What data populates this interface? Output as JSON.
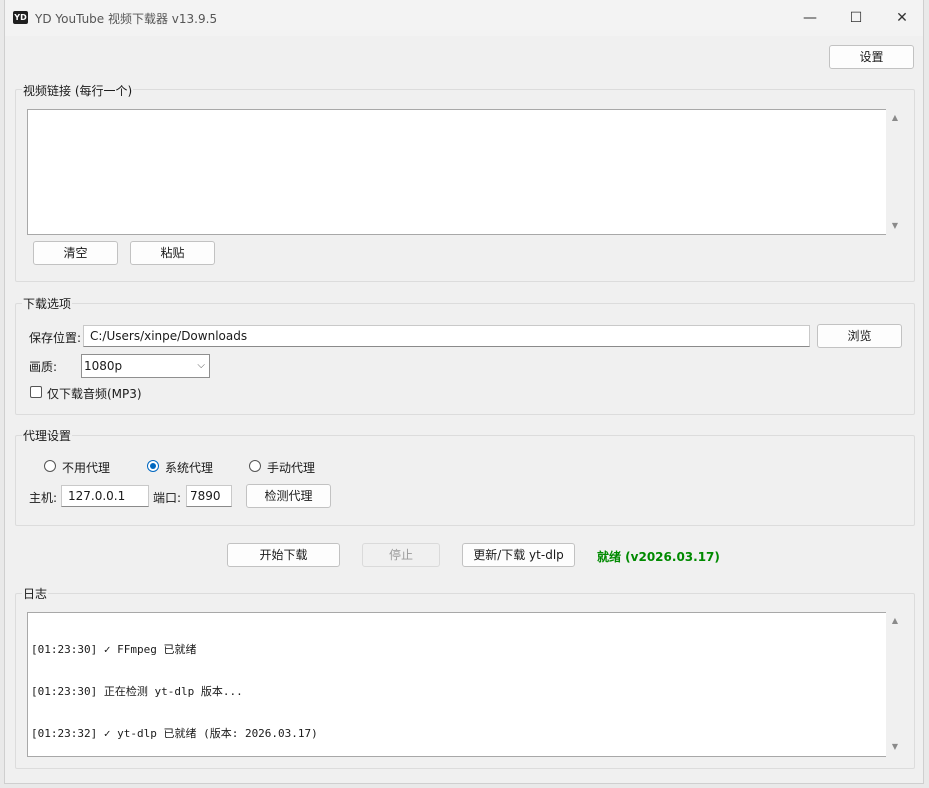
{
  "window": {
    "logo": "YD",
    "title": "YD YouTube 视频下载器 v13.9.5",
    "minimize_glyph": "—",
    "maximize_glyph": "☐",
    "close_glyph": "✕"
  },
  "toolbar": {
    "settings_label": "设置"
  },
  "urls": {
    "group_title": "视频链接 (每行一个)",
    "value": "",
    "clear_label": "清空",
    "paste_label": "粘贴"
  },
  "download_options": {
    "group_title": "下载选项",
    "save_location_label": "保存位置:",
    "save_location_value": "C:/Users/xinpe/Downloads",
    "browse_label": "浏览",
    "quality_label": "画质:",
    "quality_value": "1080p",
    "audio_only_label": "仅下载音频(MP3)",
    "audio_only_checked": false
  },
  "proxy": {
    "group_title": "代理设置",
    "options": [
      "不用代理",
      "系统代理",
      "手动代理"
    ],
    "selected": "系统代理",
    "host_label": "主机:",
    "host_value": "127.0.0.1",
    "port_label": "端口:",
    "port_value": "7890",
    "test_label": "检测代理"
  },
  "actions": {
    "start_label": "开始下载",
    "stop_label": "停止",
    "update_label": "更新/下载 yt-dlp",
    "status_text": "就绪 (v2026.03.17)",
    "status_color": "#008a00"
  },
  "log": {
    "group_title": "日志",
    "lines": [
      "[01:23:30] ✓ FFmpeg 已就绪",
      "[01:23:30] 正在检测 yt-dlp 版本...",
      "[01:23:32] ✓ yt-dlp 已就绪 (版本: 2026.03.17)"
    ]
  },
  "icons": {
    "scroll_up": "▲",
    "scroll_down": "▼",
    "dropdown": "⌵"
  }
}
